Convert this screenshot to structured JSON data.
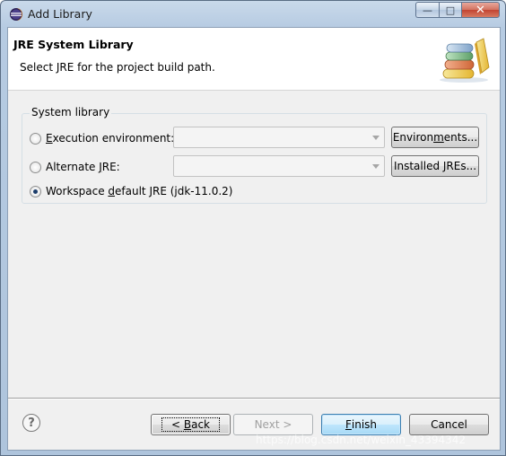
{
  "window": {
    "title": "Add Library",
    "controls": {
      "minimize": "—",
      "maximize": "□",
      "close": "✕"
    }
  },
  "banner": {
    "title": "JRE System Library",
    "description": "Select JRE for the project build path.",
    "icon": "library-books-icon"
  },
  "group": {
    "legend": "System library",
    "options": [
      {
        "pre": "",
        "mnemonic": "E",
        "post": "xecution environment:",
        "selected": false
      },
      {
        "pre": "Alternate ",
        "mnemonic": "J",
        "post": "RE:",
        "selected": false
      },
      {
        "pre": "Workspace ",
        "mnemonic": "d",
        "post": "efault JRE (jdk-11.0.2)",
        "selected": true
      }
    ],
    "environments_button": {
      "pre": "Environ",
      "mnemonic": "m",
      "post": "ents..."
    },
    "installed_jres_button": "Installed JREs...",
    "execution_env_value": "",
    "alternate_jre_value": ""
  },
  "footer": {
    "help": "?",
    "back": {
      "pre": "< ",
      "mnemonic": "B",
      "post": "ack"
    },
    "next": "Next >",
    "finish": {
      "pre": "",
      "mnemonic": "F",
      "post": "inish"
    },
    "cancel": "Cancel"
  },
  "watermark": "https://blog.csdn.net/weixin_43394342"
}
